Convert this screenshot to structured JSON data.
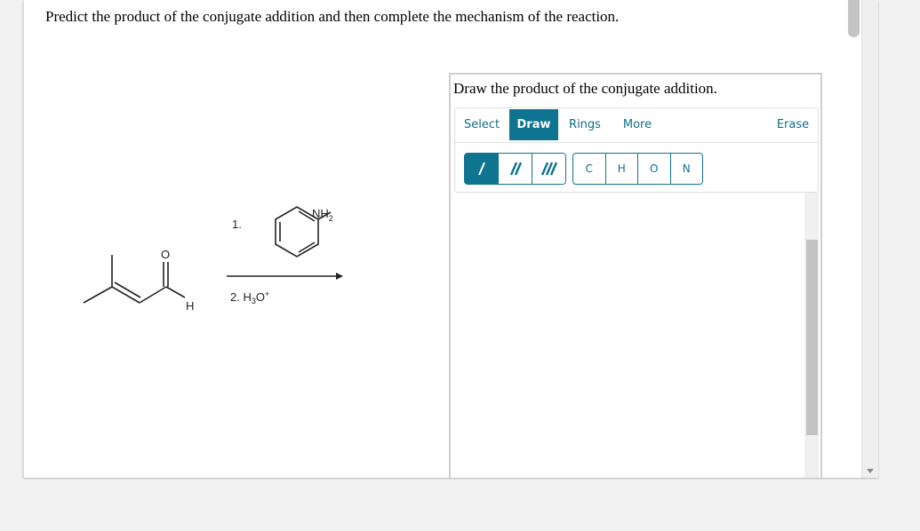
{
  "question": {
    "prompt": "Predict the product of the conjugate addition and then complete the mechanism of the reaction."
  },
  "reaction": {
    "reactant": "3-methylbut-2-enal",
    "atom_labels": {
      "oxygen": "O",
      "hydrogen": "H"
    },
    "step1_label": "1.",
    "step1_reagent_label": "NH",
    "step1_reagent_sub": "2",
    "step2_label": "2. H",
    "step2_sub": "3",
    "step2_tail": "O",
    "step2_sup": "+"
  },
  "drawing_panel": {
    "title": "Draw the product of the conjugate addition.",
    "tabs": [
      {
        "label": "Select",
        "active": false
      },
      {
        "label": "Draw",
        "active": true
      },
      {
        "label": "Rings",
        "active": false
      },
      {
        "label": "More",
        "active": false
      }
    ],
    "erase_label": "Erase",
    "bond_tools": [
      {
        "name": "single-bond",
        "active": true
      },
      {
        "name": "double-bond",
        "active": false
      },
      {
        "name": "triple-bond",
        "active": false
      }
    ],
    "atoms": [
      "C",
      "H",
      "O",
      "N"
    ]
  },
  "colors": {
    "accent": "#0e7490",
    "background": "#f2f2f2"
  }
}
